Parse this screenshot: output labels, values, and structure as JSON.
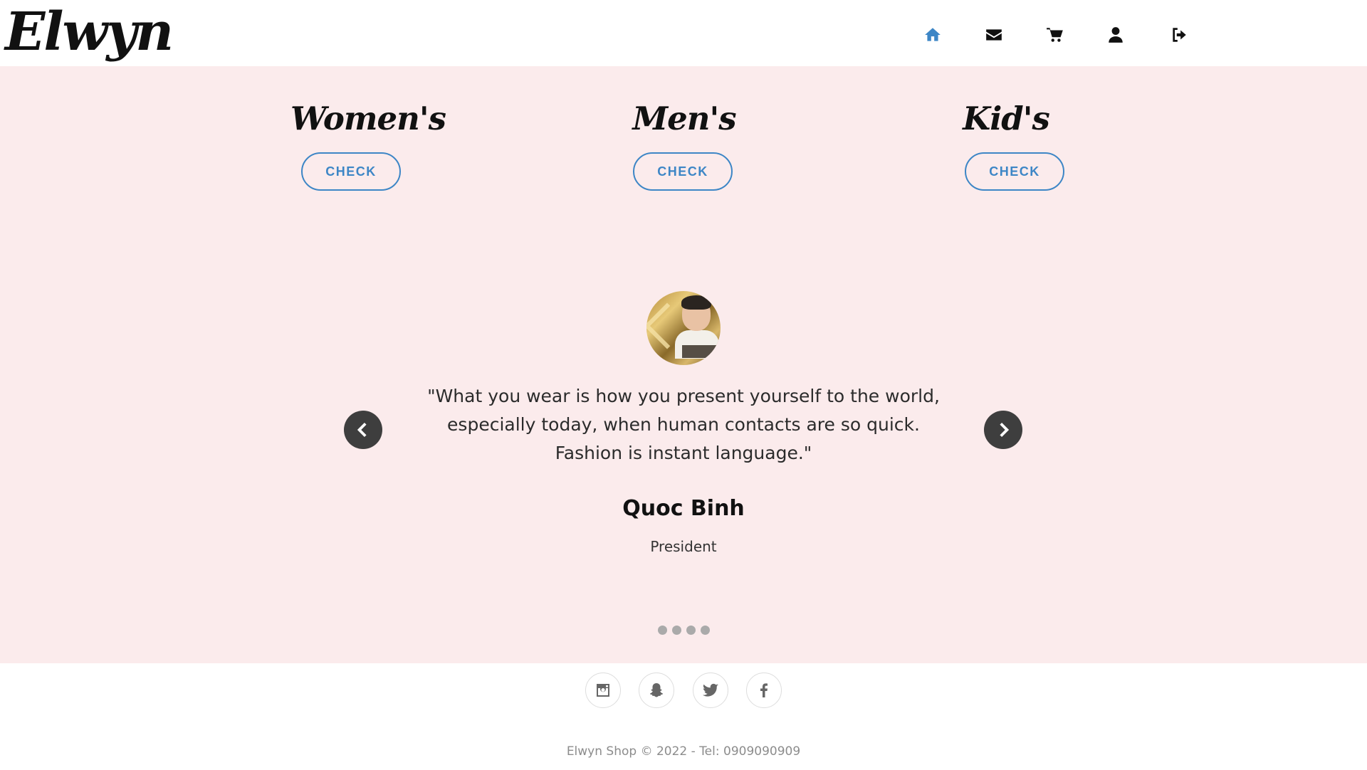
{
  "brand": {
    "logo_text": "Elwyn"
  },
  "nav": {
    "items": [
      {
        "icon": "home-icon",
        "active": true
      },
      {
        "icon": "envelope-icon",
        "active": false
      },
      {
        "icon": "cart-icon",
        "active": false
      },
      {
        "icon": "user-icon",
        "active": false
      },
      {
        "icon": "sign-out-icon",
        "active": false
      }
    ]
  },
  "categories": [
    {
      "title": "Women's",
      "button_label": "CHECK"
    },
    {
      "title": "Men's",
      "button_label": "CHECK"
    },
    {
      "title": "Kid's",
      "button_label": "CHECK"
    }
  ],
  "testimonial": {
    "quote": "\"What you wear is how you present yourself to the world, especially today, when human contacts are so quick. Fashion is instant language.\"",
    "name": "Quoc Binh",
    "role": "President",
    "slide_count": 4,
    "prev_icon": "chevron-left-icon",
    "next_icon": "chevron-right-icon"
  },
  "social": [
    {
      "icon": "instagram-icon"
    },
    {
      "icon": "snapchat-icon"
    },
    {
      "icon": "twitter-icon"
    },
    {
      "icon": "facebook-icon"
    }
  ],
  "footer": {
    "text": "Elwyn Shop © 2022 - Tel: 0909090909"
  },
  "colors": {
    "accent": "#3d86c6",
    "section_bg": "#fbebec",
    "arrow_bg": "#3e3e3e"
  }
}
